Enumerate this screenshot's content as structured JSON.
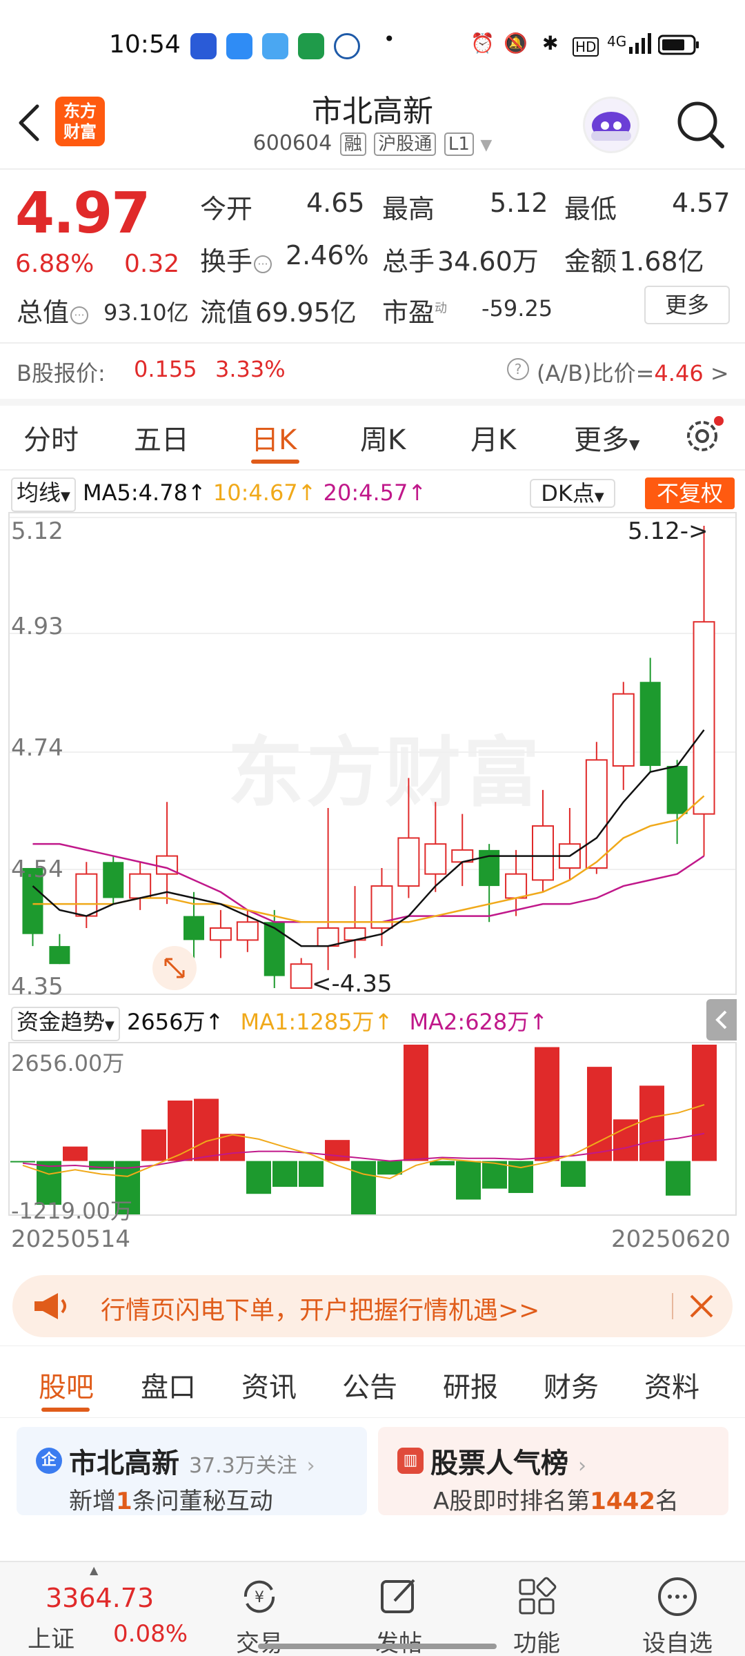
{
  "status_bar": {
    "time": "10:54",
    "dot": "•",
    "network": "4G"
  },
  "header": {
    "logo_line1": "东方",
    "logo_line2": "财富",
    "title": "市北高新",
    "code": "600604",
    "tag_rong": "融",
    "tag_hgt": "沪股通",
    "tag_l1": "L1"
  },
  "quote": {
    "price": "4.97",
    "change_pct": "6.88%",
    "change_amt": "0.32",
    "open_label": "今开",
    "open": "4.65",
    "high_label": "最高",
    "high": "5.12",
    "low_label": "最低",
    "low": "4.57",
    "turnover_label": "换手",
    "turnover": "2.46%",
    "volume_label": "总手",
    "volume": "34.60万",
    "amount_label": "金额",
    "amount": "1.68亿",
    "mktcap_label": "总值",
    "mktcap": "93.10亿",
    "float_label": "流值",
    "float": "69.95亿",
    "pe_label": "市盈",
    "pe_sup": "动",
    "pe": "-59.25",
    "more": "更多"
  },
  "b_share": {
    "label": "B股报价:",
    "price": "0.155",
    "pct": "3.33%",
    "ratio_label": "(A/B)比价=",
    "ratio": "4.46",
    "chevron": ">"
  },
  "tabs": [
    "分时",
    "五日",
    "日K",
    "周K",
    "月K",
    "更多"
  ],
  "ma_bar": {
    "selector": "均线",
    "ma5": "MA5:4.78",
    "ma10": "10:4.67",
    "ma20": "20:4.57",
    "dk": "DK点",
    "fq": "不复权"
  },
  "kline_labels": {
    "y_ticks": [
      "5.12",
      "4.93",
      "4.74",
      "4.54",
      "4.35"
    ],
    "max_note": "5.12->",
    "min_note": "<-4.35",
    "watermark": "东方财富"
  },
  "fund_flow": {
    "selector": "资金趋势",
    "value": "2656万",
    "ma1": "MA1:1285万",
    "ma2": "MA2:628万",
    "top": "2656.00万",
    "bottom": "-1219.00万",
    "date_start": "20250514",
    "date_end": "20250620"
  },
  "chart_data": {
    "type": "candlestick",
    "y_range": [
      4.35,
      5.12
    ],
    "candles": [
      {
        "o": 4.55,
        "c": 4.44,
        "h": 4.55,
        "l": 4.42,
        "color": "green"
      },
      {
        "o": 4.42,
        "c": 4.39,
        "h": 4.44,
        "l": 4.39,
        "color": "green"
      },
      {
        "o": 4.47,
        "c": 4.54,
        "h": 4.56,
        "l": 4.45,
        "color": "red"
      },
      {
        "o": 4.56,
        "c": 4.5,
        "h": 4.57,
        "l": 4.49,
        "color": "green"
      },
      {
        "o": 4.5,
        "c": 4.54,
        "h": 4.56,
        "l": 4.48,
        "color": "red"
      },
      {
        "o": 4.54,
        "c": 4.57,
        "h": 4.66,
        "l": 4.49,
        "color": "red"
      },
      {
        "o": 4.47,
        "c": 4.43,
        "h": 4.51,
        "l": 4.4,
        "color": "green"
      },
      {
        "o": 4.43,
        "c": 4.45,
        "h": 4.48,
        "l": 4.4,
        "color": "red"
      },
      {
        "o": 4.43,
        "c": 4.46,
        "h": 4.48,
        "l": 4.41,
        "color": "red"
      },
      {
        "o": 4.46,
        "c": 4.37,
        "h": 4.48,
        "l": 4.35,
        "color": "green"
      },
      {
        "o": 4.35,
        "c": 4.39,
        "h": 4.4,
        "l": 4.35,
        "color": "red"
      },
      {
        "o": 4.42,
        "c": 4.45,
        "h": 4.65,
        "l": 4.38,
        "color": "red"
      },
      {
        "o": 4.43,
        "c": 4.45,
        "h": 4.52,
        "l": 4.4,
        "color": "red"
      },
      {
        "o": 4.45,
        "c": 4.52,
        "h": 4.55,
        "l": 4.42,
        "color": "red"
      },
      {
        "o": 4.52,
        "c": 4.6,
        "h": 4.7,
        "l": 4.5,
        "color": "red"
      },
      {
        "o": 4.54,
        "c": 4.59,
        "h": 4.66,
        "l": 4.51,
        "color": "red"
      },
      {
        "o": 4.56,
        "c": 4.58,
        "h": 4.64,
        "l": 4.52,
        "color": "red"
      },
      {
        "o": 4.58,
        "c": 4.52,
        "h": 4.59,
        "l": 4.46,
        "color": "green"
      },
      {
        "o": 4.5,
        "c": 4.54,
        "h": 4.58,
        "l": 4.47,
        "color": "red"
      },
      {
        "o": 4.53,
        "c": 4.62,
        "h": 4.68,
        "l": 4.51,
        "color": "red"
      },
      {
        "o": 4.55,
        "c": 4.59,
        "h": 4.65,
        "l": 4.53,
        "color": "red"
      },
      {
        "o": 4.55,
        "c": 4.73,
        "h": 4.76,
        "l": 4.54,
        "color": "red"
      },
      {
        "o": 4.72,
        "c": 4.84,
        "h": 4.86,
        "l": 4.68,
        "color": "red"
      },
      {
        "o": 4.86,
        "c": 4.72,
        "h": 4.9,
        "l": 4.71,
        "color": "green"
      },
      {
        "o": 4.72,
        "c": 4.64,
        "h": 4.73,
        "l": 4.59,
        "color": "green"
      },
      {
        "o": 4.64,
        "c": 4.96,
        "h": 5.12,
        "l": 4.57,
        "color": "red"
      }
    ],
    "ma5": [
      4.52,
      4.48,
      4.47,
      4.49,
      4.5,
      4.51,
      4.5,
      4.49,
      4.47,
      4.45,
      4.42,
      4.42,
      4.43,
      4.44,
      4.47,
      4.52,
      4.56,
      4.57,
      4.57,
      4.57,
      4.57,
      4.6,
      4.66,
      4.71,
      4.72,
      4.78
    ],
    "ma10": [
      4.49,
      4.49,
      4.49,
      4.49,
      4.5,
      4.5,
      4.49,
      4.49,
      4.48,
      4.47,
      4.46,
      4.46,
      4.46,
      4.46,
      4.46,
      4.47,
      4.48,
      4.49,
      4.5,
      4.51,
      4.53,
      4.56,
      4.6,
      4.62,
      4.63,
      4.67
    ],
    "ma20": [
      4.59,
      4.59,
      4.58,
      4.57,
      4.56,
      4.55,
      4.53,
      4.51,
      4.48,
      4.46,
      4.46,
      4.46,
      4.46,
      4.46,
      4.47,
      4.47,
      4.47,
      4.47,
      4.48,
      4.49,
      4.49,
      4.5,
      4.52,
      4.53,
      4.54,
      4.57
    ],
    "flow_values": [
      -25,
      -1000,
      330,
      -200,
      -1219,
      720,
      1380,
      1420,
      620,
      -750,
      -590,
      -590,
      480,
      -1219,
      -310,
      2656,
      -100,
      -880,
      -630,
      -730,
      2600,
      -590,
      2150,
      950,
      1720,
      -790,
      2656
    ],
    "flow_ma1": [
      -100,
      -300,
      -200,
      -300,
      -350,
      -100,
      150,
      450,
      600,
      500,
      320,
      150,
      -100,
      -300,
      -400,
      -100,
      50,
      0,
      -50,
      -150,
      -30,
      150,
      450,
      750,
      1000,
      1100,
      1285
    ],
    "flow_ma2": [
      -50,
      -120,
      -100,
      -150,
      -160,
      -100,
      0,
      100,
      180,
      220,
      220,
      180,
      120,
      60,
      0,
      40,
      80,
      60,
      60,
      40,
      80,
      120,
      200,
      300,
      450,
      520,
      628
    ],
    "flow_range": [
      -1219,
      2656
    ],
    "colors": {
      "up": "#e02a2a",
      "down": "#1d9a2e",
      "ma5": "#111111",
      "ma10": "#f0a91a",
      "ma20": "#c0188a"
    }
  },
  "banner": {
    "text": "行情页闪电下单，开户把握行情机遇>>"
  },
  "bottom_tabs": [
    "股吧",
    "盘口",
    "资讯",
    "公告",
    "研报",
    "财务",
    "资料"
  ],
  "cards": {
    "left_title": "市北高新",
    "left_follow": "37.3万关注",
    "left_sub_pre": "新增",
    "left_sub_num": "1",
    "left_sub_post": "条问董秘互动",
    "right_title": "股票人气榜",
    "right_sub_pre": "A股即时排名第",
    "right_sub_num": "1442",
    "right_sub_post": "名"
  },
  "bottom_nav": {
    "index_value": "3364.73",
    "index_name": "上证",
    "index_pct": "0.08%",
    "trade": "交易",
    "post": "发帖",
    "func": "功能",
    "watch": "设自选"
  }
}
